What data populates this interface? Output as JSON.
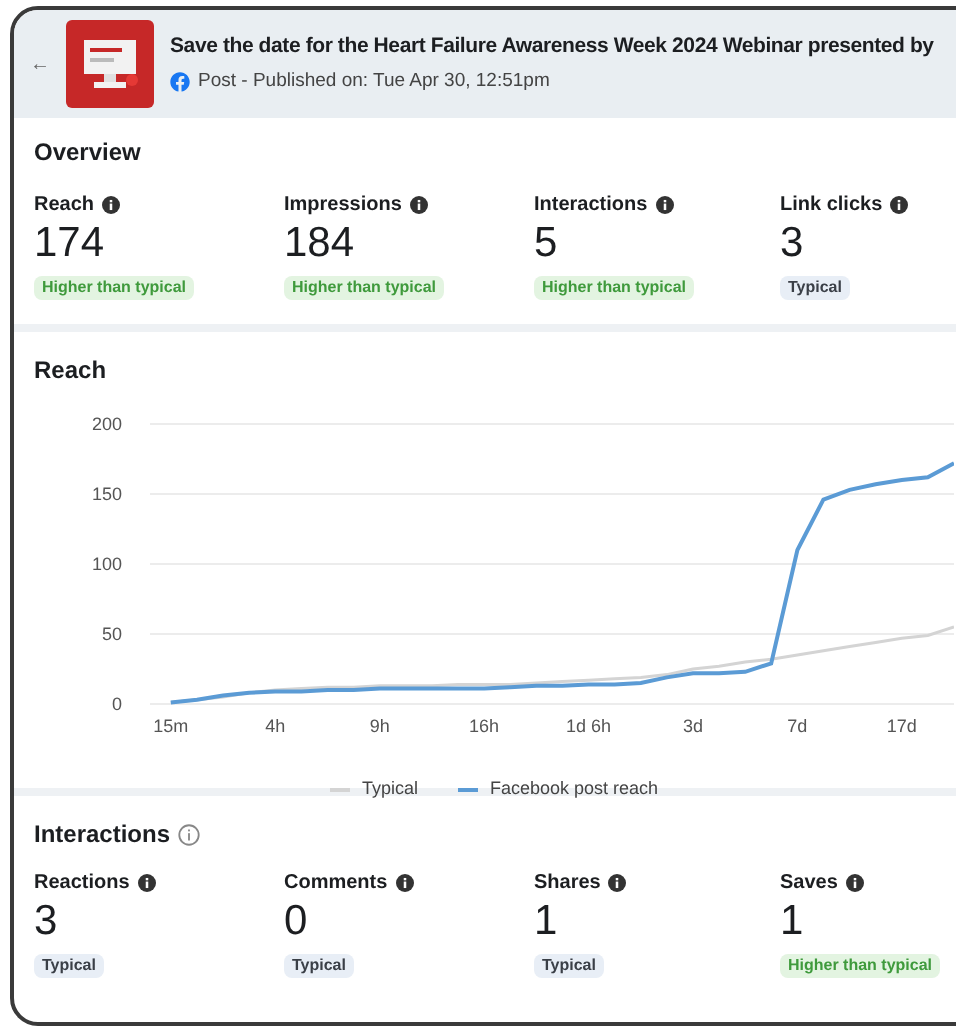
{
  "header": {
    "back": "←",
    "title": "Save the date for the Heart Failure Awareness Week 2024 Webinar presented by",
    "subtitle": "Post - Published on: Tue Apr 30, 12:51pm"
  },
  "overview": {
    "title": "Overview",
    "metrics": [
      {
        "label": "Reach",
        "value": "174",
        "badge": "Higher than typical",
        "kind": "higher"
      },
      {
        "label": "Impressions",
        "value": "184",
        "badge": "Higher than typical",
        "kind": "higher"
      },
      {
        "label": "Interactions",
        "value": "5",
        "badge": "Higher than typical",
        "kind": "higher"
      },
      {
        "label": "Link clicks",
        "value": "3",
        "badge": "Typical",
        "kind": "typical"
      }
    ]
  },
  "reach": {
    "title": "Reach",
    "chart_data": {
      "type": "line",
      "categories": [
        "15m",
        null,
        null,
        null,
        "4h",
        null,
        null,
        null,
        "9h",
        null,
        null,
        null,
        "16h",
        null,
        null,
        null,
        "1d 6h",
        null,
        null,
        null,
        "3d",
        null,
        null,
        null,
        "7d",
        null,
        null,
        null,
        "17d",
        null,
        null
      ],
      "ylim": [
        0,
        200
      ],
      "yticks": [
        0,
        50,
        100,
        150,
        200
      ],
      "grid": true,
      "series": [
        {
          "name": "Typical",
          "color": "#d4d4d4",
          "values": [
            1,
            3,
            5,
            8,
            10,
            11,
            12,
            12,
            13,
            13,
            13,
            14,
            14,
            14,
            15,
            16,
            17,
            18,
            19,
            21,
            25,
            27,
            30,
            32,
            35,
            38,
            41,
            44,
            47,
            49,
            55
          ]
        },
        {
          "name": "Facebook post reach",
          "color": "#5b9bd5",
          "values": [
            1,
            3,
            6,
            8,
            9,
            9,
            10,
            10,
            11,
            11,
            11,
            11,
            11,
            12,
            13,
            13,
            14,
            14,
            15,
            19,
            22,
            22,
            23,
            29,
            110,
            146,
            153,
            157,
            160,
            162,
            172
          ]
        }
      ]
    }
  },
  "interactions": {
    "title": "Interactions",
    "metrics": [
      {
        "label": "Reactions",
        "value": "3",
        "badge": "Typical",
        "kind": "typical"
      },
      {
        "label": "Comments",
        "value": "0",
        "badge": "Typical",
        "kind": "typical"
      },
      {
        "label": "Shares",
        "value": "1",
        "badge": "Typical",
        "kind": "typical"
      },
      {
        "label": "Saves",
        "value": "1",
        "badge": "Higher than typical",
        "kind": "higher"
      }
    ]
  }
}
